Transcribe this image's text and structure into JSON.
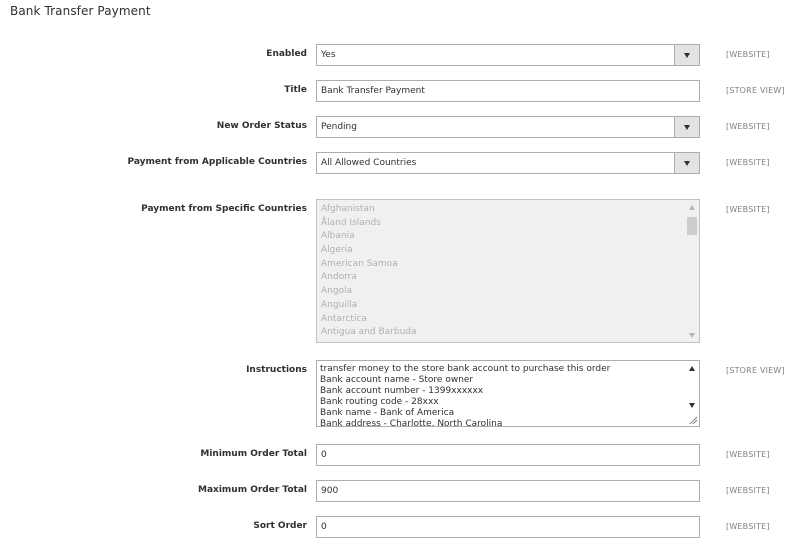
{
  "section": {
    "title": "Bank Transfer Payment"
  },
  "fields": {
    "enabled": {
      "label": "Enabled",
      "value": "Yes",
      "scope": "[WEBSITE]"
    },
    "title": {
      "label": "Title",
      "value": "Bank Transfer Payment",
      "scope": "[STORE VIEW]"
    },
    "new_order_status": {
      "label": "New Order Status",
      "value": "Pending",
      "scope": "[WEBSITE]"
    },
    "applicable_countries": {
      "label": "Payment from Applicable Countries",
      "value": "All Allowed Countries",
      "scope": "[WEBSITE]"
    },
    "specific_countries": {
      "label": "Payment from Specific Countries",
      "scope": "[WEBSITE]",
      "options": [
        "Afghanistan",
        "Åland Islands",
        "Albania",
        "Algeria",
        "American Samoa",
        "Andorra",
        "Angola",
        "Anguilla",
        "Antarctica",
        "Antigua and Barbuda"
      ]
    },
    "instructions": {
      "label": "Instructions",
      "scope": "[STORE VIEW]",
      "lines": [
        "transfer money to the store bank account to purchase this order",
        "Bank account name - Store owner",
        "Bank account number - 1399xxxxxx",
        "Bank routing code - 28xxx",
        "Bank name - Bank of America",
        "Bank address - Charlotte, North Carolina"
      ]
    },
    "min_order_total": {
      "label": "Minimum Order Total",
      "value": "0",
      "scope": "[WEBSITE]"
    },
    "max_order_total": {
      "label": "Maximum Order Total",
      "value": "900",
      "scope": "[WEBSITE]"
    },
    "sort_order": {
      "label": "Sort Order",
      "value": "0",
      "scope": "[WEBSITE]"
    }
  },
  "colors": {
    "border": "#adadad",
    "disabled_bg": "#f0f0f0",
    "disabled_text": "#b0b0b0",
    "scope_text": "#808080",
    "label_text": "#303030"
  }
}
